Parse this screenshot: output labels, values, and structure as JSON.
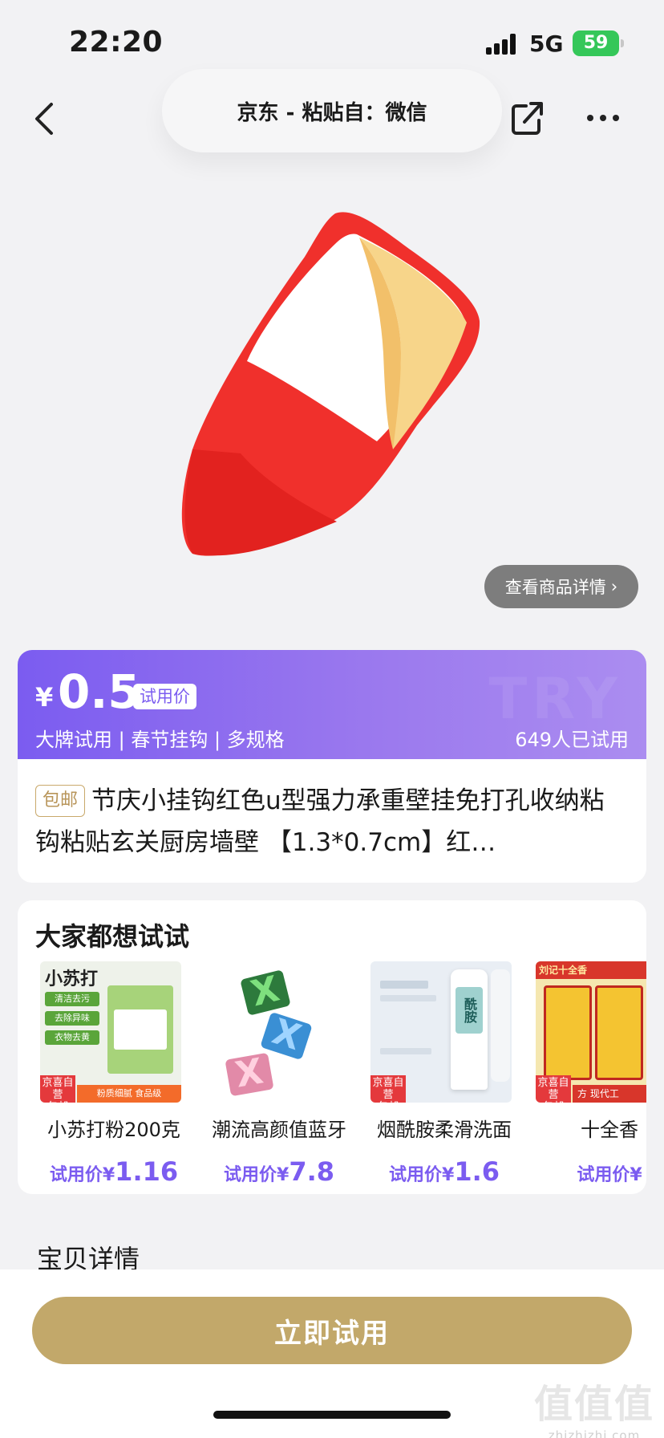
{
  "status": {
    "time": "22:20",
    "network": "5G",
    "battery": "59"
  },
  "nav": {
    "title": "京东 - 粘贴自：微信"
  },
  "product": {
    "detail_link": "查看商品详情"
  },
  "price": {
    "symbol": "¥",
    "value": "0.5",
    "tag": "试用价",
    "tags": "大牌试用 | 春节挂钩 | 多规格",
    "tried": "649人已试用",
    "watermark": "TRY"
  },
  "title": {
    "badge": "包邮",
    "text": "节庆小挂钩红色u型强力承重壁挂免打孔收纳粘钩粘贴玄关厨房墙壁 【1.3*0.7cm】红…"
  },
  "try_section": {
    "heading": "大家都想试试",
    "items": [
      {
        "name": "小苏打粉200克",
        "price_label": "试用价¥",
        "price": "1.16",
        "thumb_text": "小苏打",
        "tags": [
          "清洁去污",
          "去除异味",
          "衣物去黄"
        ],
        "strip": "粉质细腻 食品级",
        "badge_line1": "京喜自营",
        "badge_line2": "包邮"
      },
      {
        "name": "潮流高颜值蓝牙",
        "price_label": "试用价¥",
        "price": "7.8"
      },
      {
        "name": "烟酰胺柔滑洗面",
        "price_label": "试用价¥",
        "price": "1.6",
        "thumb_text": "酰胺",
        "badge_line1": "京喜自营",
        "badge_line2": "包邮"
      },
      {
        "name": "十全香",
        "price_label": "试用价¥",
        "price": "",
        "thumb_text": "刘记十全香",
        "strip": "方 现代工",
        "badge_line1": "京喜自营",
        "badge_line2": "包邮"
      }
    ]
  },
  "detail_section": {
    "heading": "宝贝详情"
  },
  "bottom": {
    "button": "立即试用"
  },
  "watermark": {
    "big": "值值值",
    "small": "zhizhizhi.com"
  },
  "colors": {
    "accent": "#7b5cf0",
    "gold": "#c2a86a",
    "red": "#e4393c"
  }
}
